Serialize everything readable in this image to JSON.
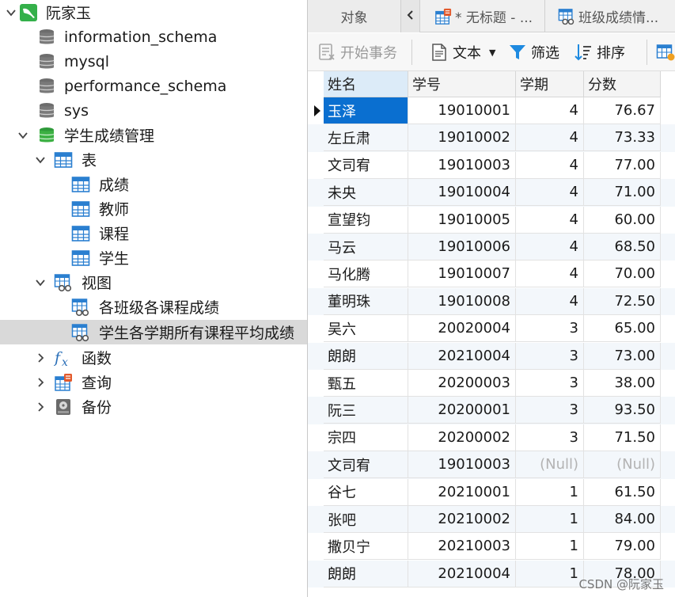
{
  "tree": {
    "connection": {
      "label": "阮家玉",
      "icon": "mysql-connection-icon"
    },
    "databases": [
      {
        "label": "information_schema",
        "icon": "database-icon"
      },
      {
        "label": "mysql",
        "icon": "database-icon"
      },
      {
        "label": "performance_schema",
        "icon": "database-icon"
      },
      {
        "label": "sys",
        "icon": "database-icon"
      },
      {
        "label": "学生成绩管理",
        "icon": "database-open-icon"
      }
    ],
    "tables_group": {
      "label": "表",
      "icon": "table-icon"
    },
    "tables": [
      {
        "label": "成绩",
        "icon": "table-icon"
      },
      {
        "label": "教师",
        "icon": "table-icon"
      },
      {
        "label": "课程",
        "icon": "table-icon"
      },
      {
        "label": "学生",
        "icon": "table-icon"
      }
    ],
    "views_group": {
      "label": "视图",
      "icon": "view-icon"
    },
    "views": [
      {
        "label": "各班级各课程成绩",
        "icon": "view-icon"
      },
      {
        "label": "学生各学期所有课程平均成绩",
        "icon": "view-icon",
        "selected": true
      }
    ],
    "functions_group": {
      "label": "函数",
      "icon": "function-icon"
    },
    "queries_group": {
      "label": "查询",
      "icon": "query-icon"
    },
    "backups_group": {
      "label": "备份",
      "icon": "backup-icon"
    }
  },
  "tabs": {
    "objects": "对象",
    "untitled": "* 无标题 - ...",
    "view": "班级成绩情..."
  },
  "toolbar": {
    "begin_transaction": "开始事务",
    "text": "文本",
    "filter": "筛选",
    "sort": "排序"
  },
  "grid": {
    "columns": [
      "姓名",
      "学号",
      "学期",
      "分数"
    ],
    "rows": [
      [
        "玉泽",
        "19010001",
        "4",
        "76.67"
      ],
      [
        "左丘肃",
        "19010002",
        "4",
        "73.33"
      ],
      [
        "文司宥",
        "19010003",
        "4",
        "77.00"
      ],
      [
        "未央",
        "19010004",
        "4",
        "71.00"
      ],
      [
        "宣望钧",
        "19010005",
        "4",
        "60.00"
      ],
      [
        "马云",
        "19010006",
        "4",
        "68.50"
      ],
      [
        "马化腾",
        "19010007",
        "4",
        "70.00"
      ],
      [
        "董明珠",
        "19010008",
        "4",
        "72.50"
      ],
      [
        "吴六",
        "20020004",
        "3",
        "65.00"
      ],
      [
        "朗朗",
        "20210004",
        "3",
        "73.00"
      ],
      [
        "甄五",
        "20200003",
        "3",
        "38.00"
      ],
      [
        "阮三",
        "20200001",
        "3",
        "93.50"
      ],
      [
        "宗四",
        "20200002",
        "3",
        "71.50"
      ],
      [
        "文司宥",
        "19010003",
        "(Null)",
        "(Null)"
      ],
      [
        "谷七",
        "20210001",
        "1",
        "61.50"
      ],
      [
        "张吧",
        "20210002",
        "1",
        "84.00"
      ],
      [
        "撒贝宁",
        "20210003",
        "1",
        "79.00"
      ],
      [
        "朗朗",
        "20210004",
        "1",
        "78.00"
      ]
    ]
  },
  "watermark": "CSDN @阮家玉",
  "colors": {
    "selection": "#0a6fd0",
    "accent": "#1e8ae0",
    "db_green": "#3cb043"
  }
}
